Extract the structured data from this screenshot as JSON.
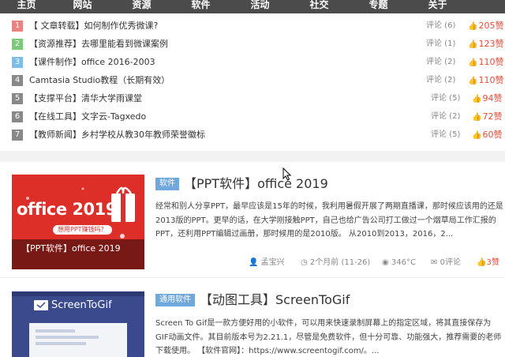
{
  "nav": {
    "items": [
      "主页",
      "网站",
      "资源",
      "软件",
      "活动",
      "社交",
      "专题",
      "关于"
    ]
  },
  "ranking": {
    "badge_colors": [
      "#f08080",
      "#7bc97b",
      "#7cbee8",
      "#888888",
      "#888888",
      "#888888",
      "#888888"
    ],
    "items": [
      {
        "num": "1",
        "title": "【 文章转载】如何制作优秀微课?",
        "comments": "评论 (6)",
        "likes": "205赞"
      },
      {
        "num": "2",
        "title": "【资源推荐】去哪里能看到微课案例",
        "comments": "评论 (1)",
        "likes": "123赞"
      },
      {
        "num": "3",
        "title": "【课件制作】office 2016-2003",
        "comments": "评论 (2)",
        "likes": "110赞"
      },
      {
        "num": "4",
        "title": "Camtasia Studio教程（长期有效）",
        "comments": "评论 (2)",
        "likes": "110赞"
      },
      {
        "num": "5",
        "title": "【支撑平台】清华大学雨课堂",
        "comments": "评论 (5)",
        "likes": "94赞"
      },
      {
        "num": "6",
        "title": "【在线工具】文字云-Tagxedo",
        "comments": "评论 (2)",
        "likes": "72赞"
      },
      {
        "num": "7",
        "title": "【教师新闻】乡村学校从教30年教师荣誉徽标",
        "comments": "评论 (5)",
        "likes": "60赞"
      }
    ]
  },
  "articles": [
    {
      "category": "软件",
      "title": "【PPT软件】office 2019",
      "thumb_text": "office 2019",
      "thumb_subtext": "想用PPT赚钱吗？",
      "thumb_caption": "【PPT软件】office 2019",
      "excerpt": "经常和别人分享PPT，最早应该是15年的时候，我利用暑假开展了两期直播课，那时候应该用的还是2013版的PPT。更早的话，在大学刚接触PPT，自己也给广告公司打工做过一个烟草局工作汇报的PPT，还利用PPT编辑过画册，那时候用的是2010版。 从2010到2013，2016，2...",
      "author": "孟宝兴",
      "time": "2个月前 (11-26)",
      "views": "346°C",
      "comments": "0评论",
      "likes": "3赞"
    },
    {
      "category": "通用软件",
      "title": "【动图工具】ScreenToGif",
      "thumb_text": "ScreenToGif",
      "excerpt": "Screen To Gif是一款方便好用的小软件，可以用来快速录制屏幕上的指定区域，将其直接保存为GIF动画文件。其目前版本号为2.21.1，尽管是免费软件，但十分可靠、功能强大，推荐需要的老师下载使用。 【软件官网】：https://www.screentogif.com/。..."
    }
  ],
  "colors": {
    "nav_bg": "#4b4b4b",
    "badge_blue": "#6ea8dc",
    "like_red": "#e74c3c",
    "thumb1_bg": "#e8382c",
    "thumb2_bg": "#3a4a8c"
  },
  "icons": [
    "thumb-up-icon",
    "user-icon",
    "clock-icon",
    "eye-icon",
    "comment-icon",
    "cursor-icon"
  ]
}
